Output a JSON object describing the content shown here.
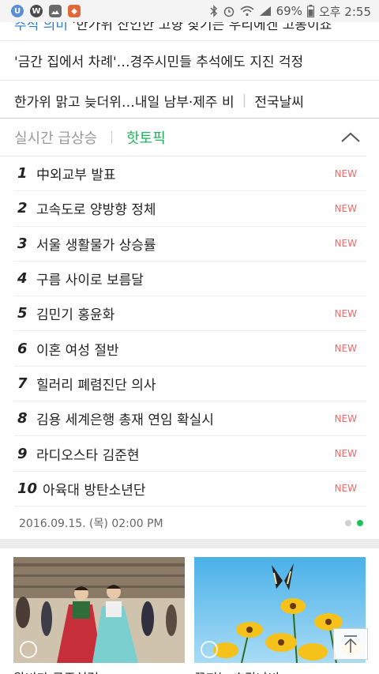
{
  "status_bar": {
    "battery": "69%",
    "time": "오후 2:55",
    "colors": {
      "app1": "#5a8fd8",
      "app2": "#4b4b4b",
      "app3": "#6a6a6a",
      "app4": "#e0693a"
    }
  },
  "top_news": {
    "partial": {
      "category": "추석 의미",
      "text": " '한가위 잔인한 고향 찾기는 우리에겐 고통이죠"
    },
    "items": [
      {
        "text": "'금간 집에서 차례'…경주시민들 추석에도 지진 걱정"
      },
      {
        "text": "한가위 맑고 늦더위…내일 남부·제주 비",
        "extra": "전국날씨"
      }
    ]
  },
  "realtime": {
    "tab_realtime": "실시간 급상승",
    "tab_hottopic": "핫토픽",
    "items": [
      {
        "rank": "1",
        "text": "中외교부 발표",
        "badge": "NEW"
      },
      {
        "rank": "2",
        "text": "고속도로 양방향 정체",
        "badge": "NEW"
      },
      {
        "rank": "3",
        "text": "서울 생활물가 상승률",
        "badge": "NEW"
      },
      {
        "rank": "4",
        "text": "구름 사이로 보름달",
        "badge": ""
      },
      {
        "rank": "5",
        "text": "김민기 홍윤화",
        "badge": "NEW"
      },
      {
        "rank": "6",
        "text": "이혼 여성 절반",
        "badge": "NEW"
      },
      {
        "rank": "7",
        "text": "힐러리 폐렴진단 의사",
        "badge": ""
      },
      {
        "rank": "8",
        "text": "김용 세계은행 총재 연임 확실시",
        "badge": "NEW"
      },
      {
        "rank": "9",
        "text": "라디오스타 김준현",
        "badge": "NEW"
      },
      {
        "rank": "10",
        "text": "아육대 방탄소년단",
        "badge": "NEW"
      }
    ],
    "timestamp": "2016.09.15. (목) 02:00 PM",
    "accent_color": "#20b45a",
    "badge_color": "#f06a6a"
  },
  "photos": {
    "cards": [
      {
        "caption": "왕비가 공주처럼"
      },
      {
        "caption": "꽃피는 호랑나비"
      }
    ]
  }
}
